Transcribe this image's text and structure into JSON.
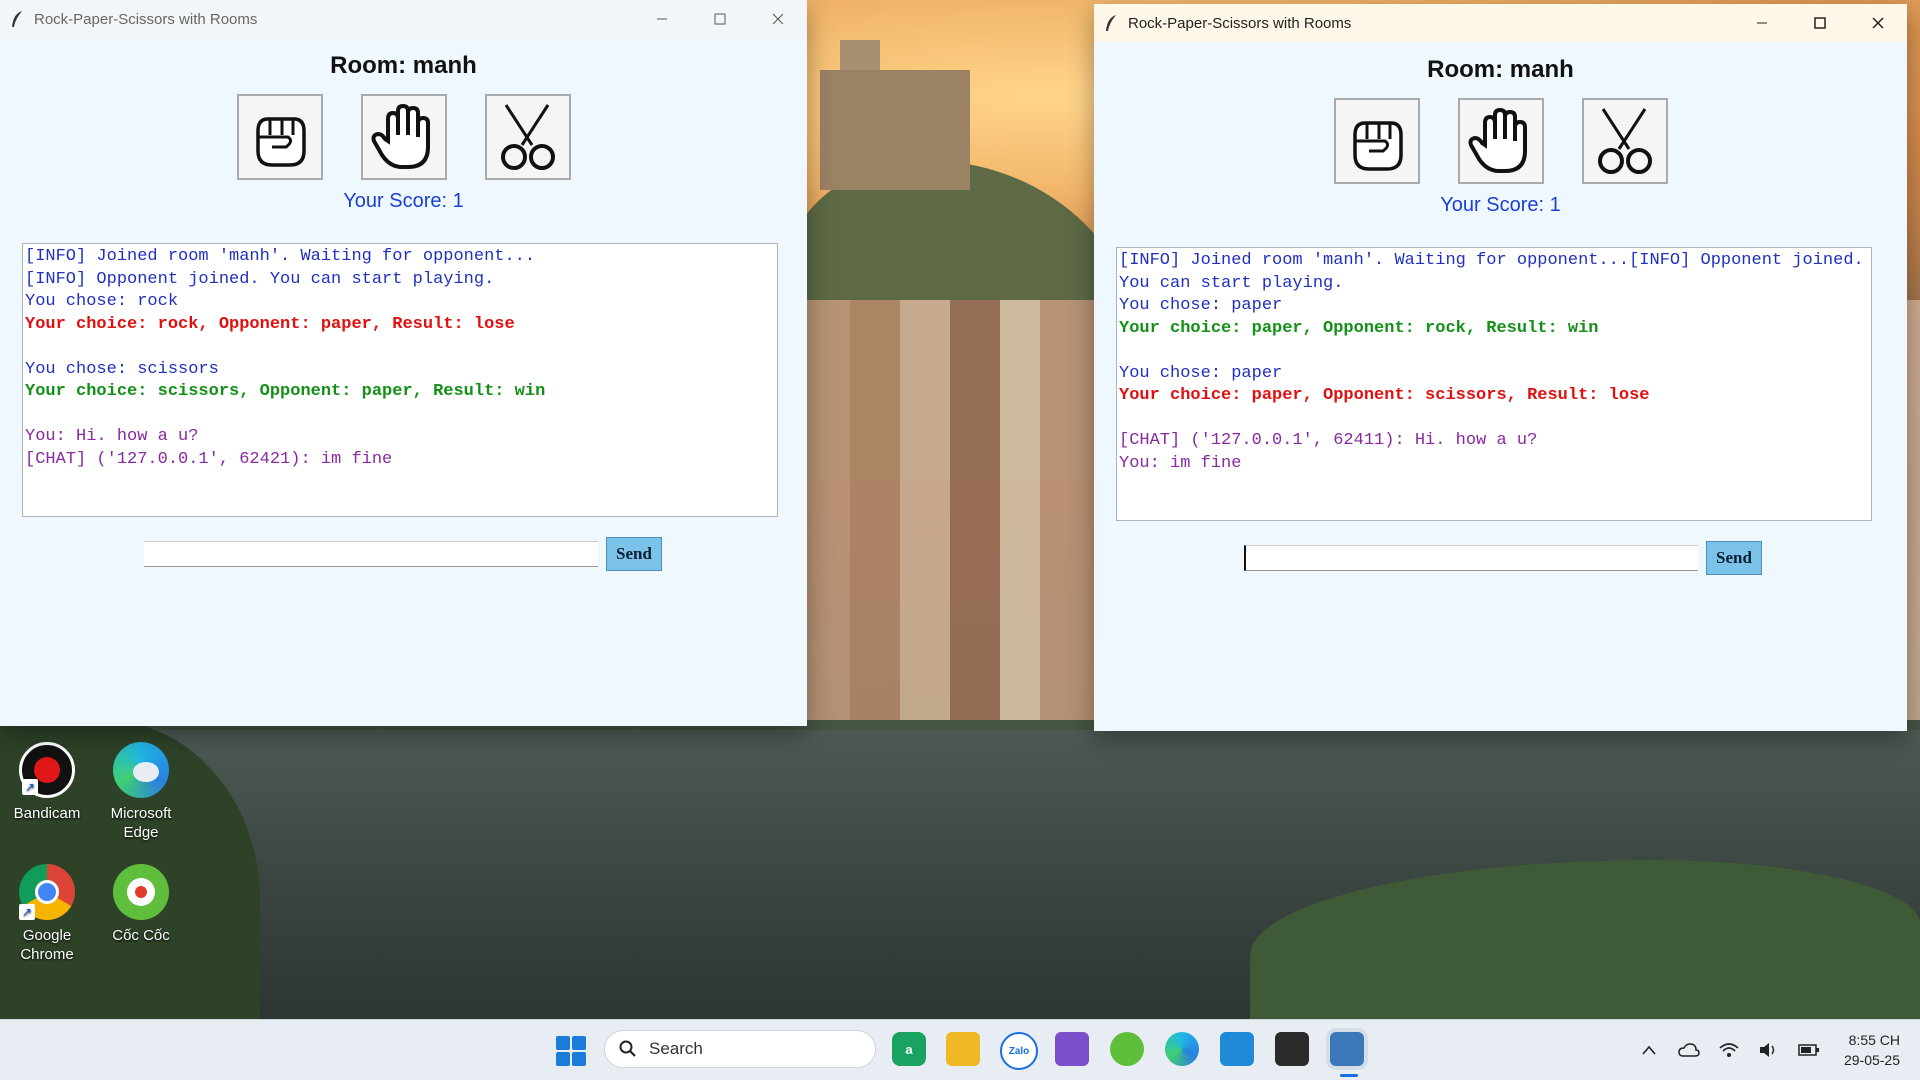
{
  "desktop": {
    "icons": [
      {
        "label_line1": "Bandicam",
        "label_line2": ""
      },
      {
        "label_line1": "Microsoft",
        "label_line2": "Edge"
      },
      {
        "label_line1": "Google",
        "label_line2": "Chrome"
      },
      {
        "label_line1": "Cốc Cốc",
        "label_line2": ""
      }
    ]
  },
  "window_left": {
    "title": "Rock-Paper-Scissors with Rooms",
    "room_label": "Room: manh",
    "score_label": "Your Score: 1",
    "log": [
      {
        "text": "[INFO] Joined room 'manh'. Waiting for opponent...",
        "kind": "info"
      },
      {
        "text": "[INFO] Opponent joined. You can start playing.",
        "kind": "info"
      },
      {
        "text": "You chose: rock",
        "kind": "info"
      },
      {
        "text": "Your choice: rock, Opponent: paper, Result: lose",
        "kind": "lose"
      },
      {
        "text": "",
        "kind": "info"
      },
      {
        "text": "You chose: scissors",
        "kind": "info"
      },
      {
        "text": "Your choice: scissors, Opponent: paper, Result: win",
        "kind": "win"
      },
      {
        "text": "",
        "kind": "info"
      },
      {
        "text": "You: Hi. how a u?",
        "kind": "chat"
      },
      {
        "text": "[CHAT] ('127.0.0.1', 62421): im fine",
        "kind": "chat"
      }
    ],
    "message_value": "",
    "send_label": "Send"
  },
  "window_right": {
    "title": "Rock-Paper-Scissors with Rooms",
    "room_label": "Room: manh",
    "score_label": "Your Score: 1",
    "log": [
      {
        "text": "[INFO] Joined room 'manh'. Waiting for opponent...[INFO] Opponent joined. You can start playing.",
        "kind": "info"
      },
      {
        "text": "You chose: paper",
        "kind": "info"
      },
      {
        "text": "Your choice: paper, Opponent: rock, Result: win",
        "kind": "win"
      },
      {
        "text": "",
        "kind": "info"
      },
      {
        "text": "You chose: paper",
        "kind": "info"
      },
      {
        "text": "Your choice: paper, Opponent: scissors, Result: lose",
        "kind": "lose"
      },
      {
        "text": "",
        "kind": "info"
      },
      {
        "text": "[CHAT] ('127.0.0.1', 62411): Hi. how a u?",
        "kind": "chat"
      },
      {
        "text": "You: im fine",
        "kind": "chat"
      }
    ],
    "message_value": "",
    "send_label": "Send"
  },
  "taskbar": {
    "search_label": "Search",
    "clock_time": "8:55 CH",
    "clock_date": "29-05-25",
    "apps": [
      "a",
      "Zalo"
    ]
  },
  "colors": {
    "info": "#2030c0",
    "lose": "#e01010",
    "win": "#149018",
    "chat": "#882aa0",
    "score": "#1a3fd6",
    "send_button": "#7cc3ea"
  }
}
